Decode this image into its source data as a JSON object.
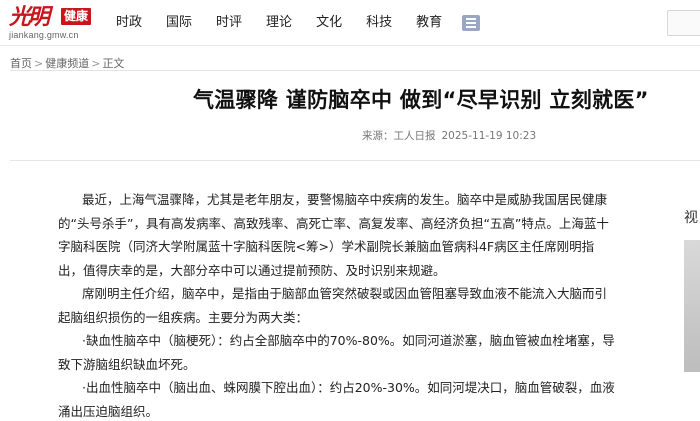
{
  "header": {
    "logo_mark": "光明",
    "logo_tag": "健康",
    "logo_url": "jiankang.gmw.cn",
    "nav": [
      "时政",
      "国际",
      "时评",
      "理论",
      "文化",
      "科技",
      "教育"
    ]
  },
  "breadcrumb": {
    "items": [
      "首页",
      "健康频道",
      "正文"
    ],
    "separator": ">"
  },
  "article": {
    "title": "气温骤降 谨防脑卒中 做到“尽早识别 立刻就医”",
    "source": "来源：工人日报",
    "date": "2025-11-19 10:23",
    "paragraphs": [
      "最近，上海气温骤降，尤其是老年朋友，要警惕脑卒中疾病的发生。脑卒中是威胁我国居民健康的“头号杀手”，具有高发病率、高致残率、高死亡率、高复发率、高经济负担“五高”特点。上海蓝十字脑科医院（同济大学附属蓝十字脑科医院<筹>）学术副院长兼脑血管病科4F病区主任席刚明指出，值得庆幸的是，大部分卒中可以通过提前预防、及时识别来规避。",
      "席刚明主任介绍，脑卒中，是指由于脑部血管突然破裂或因血管阻塞导致血液不能流入大脑而引起脑组织损伤的一组疾病。主要分为两大类：",
      "·缺血性脑卒中（脑梗死）：约占全部脑卒中的70%-80%。如同河道淤塞，脑血管被血栓堵塞，导致下游脑组织缺血坏死。",
      "·出血性脑卒中（脑出血、蛛网膜下腔出血）：约占20%-30%。如同河堤决口，脑血管破裂，血液涌出压迫脑组织。"
    ]
  },
  "sidebar": {
    "title": "视"
  }
}
